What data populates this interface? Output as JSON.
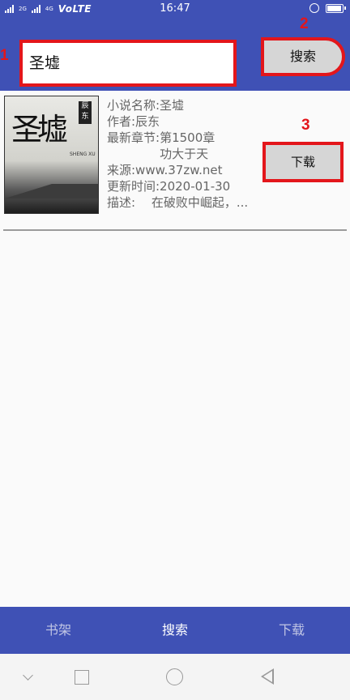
{
  "status_bar": {
    "network_1": "2G",
    "network_2": "4G",
    "volte": "VoLTE",
    "time": "16:47"
  },
  "search": {
    "query": "圣墟",
    "button_label": "搜索"
  },
  "annotations": {
    "a1": "1",
    "a2": "2",
    "a3": "3"
  },
  "result": {
    "cover_title": "圣墟",
    "cover_author": "辰东",
    "cover_sub": "SHENG XU",
    "name": "小说名称:圣墟",
    "author": "作者:辰东",
    "latest_label": "最新章节:",
    "latest_value": "第1500章 功大于天",
    "source": "来源:www.37zw.net",
    "updated": "更新时间:2020-01-30",
    "desc": "描述:　 在破败中崛起，...",
    "download_label": "下载"
  },
  "tabs": {
    "shelf": "书架",
    "search": "搜索",
    "download": "下载"
  },
  "colors": {
    "primary": "#3f51b5",
    "annotation": "#e3161b"
  }
}
